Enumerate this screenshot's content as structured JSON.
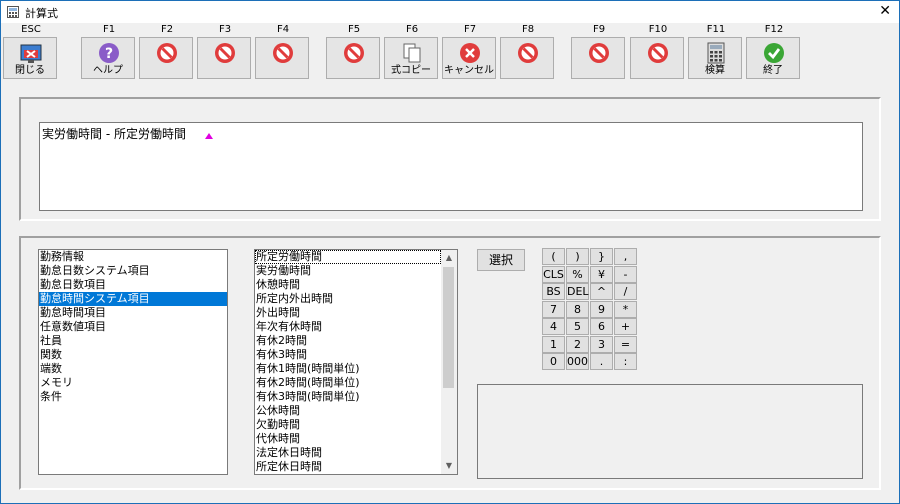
{
  "window": {
    "title": "計算式",
    "close_glyph": "✕"
  },
  "toolbar": {
    "keys": [
      {
        "key": "ESC",
        "caption": "閉じる",
        "icon": "close-window-icon"
      },
      {
        "key": "F1",
        "caption": "ヘルプ",
        "icon": "help-icon"
      },
      {
        "key": "F2",
        "caption": "",
        "icon": "disabled-icon"
      },
      {
        "key": "F3",
        "caption": "",
        "icon": "disabled-icon"
      },
      {
        "key": "F4",
        "caption": "",
        "icon": "disabled-icon"
      },
      {
        "key": "F5",
        "caption": "",
        "icon": "disabled-icon"
      },
      {
        "key": "F6",
        "caption": "式コピー",
        "icon": "copy-icon"
      },
      {
        "key": "F7",
        "caption": "キャンセル",
        "icon": "cancel-icon"
      },
      {
        "key": "F8",
        "caption": "",
        "icon": "disabled-icon"
      },
      {
        "key": "F9",
        "caption": "",
        "icon": "disabled-icon"
      },
      {
        "key": "F10",
        "caption": "",
        "icon": "disabled-icon"
      },
      {
        "key": "F11",
        "caption": "検算",
        "icon": "calculator-icon"
      },
      {
        "key": "F12",
        "caption": "終了",
        "icon": "check-icon"
      }
    ]
  },
  "formula": {
    "text": "実労働時間 - 所定労働時間"
  },
  "category_list": {
    "items": [
      "勤務情報",
      "勤怠日数システム項目",
      "勤怠日数項目",
      "勤怠時間システム項目",
      "勤怠時間項目",
      "任意数値項目",
      "社員",
      "関数",
      "端数",
      "メモリ",
      "条件"
    ],
    "selected_index": 3
  },
  "item_list": {
    "items": [
      "所定労働時間",
      "実労働時間",
      "休憩時間",
      "所定内外出時間",
      "外出時間",
      "年次有休時間",
      "有休2時間",
      "有休3時間",
      "有休1時間(時間単位)",
      "有休2時間(時間単位)",
      "有休3時間(時間単位)",
      "公休時間",
      "欠勤時間",
      "代休時間",
      "法定休日時間",
      "所定休日時間"
    ],
    "focused_index": 0,
    "scroll_up": "▲",
    "scroll_down": "▼"
  },
  "select_button": {
    "label": "選択"
  },
  "keypad": {
    "rows": [
      [
        "(",
        ")",
        "}",
        ","
      ],
      [
        "CLS",
        "%",
        "¥",
        "-"
      ],
      [
        "BS",
        "DEL",
        "^",
        "/"
      ],
      [
        "7",
        "8",
        "9",
        "*"
      ],
      [
        "4",
        "5",
        "6",
        "+"
      ],
      [
        "1",
        "2",
        "3",
        "="
      ],
      [
        "0",
        "000",
        ".",
        ":"
      ]
    ]
  },
  "colors": {
    "selection": "#0078d7",
    "caret": "#e000e0",
    "disabled_red": "#e03c3c",
    "help_purple": "#8a5cc8",
    "ok_green": "#3aa635"
  }
}
